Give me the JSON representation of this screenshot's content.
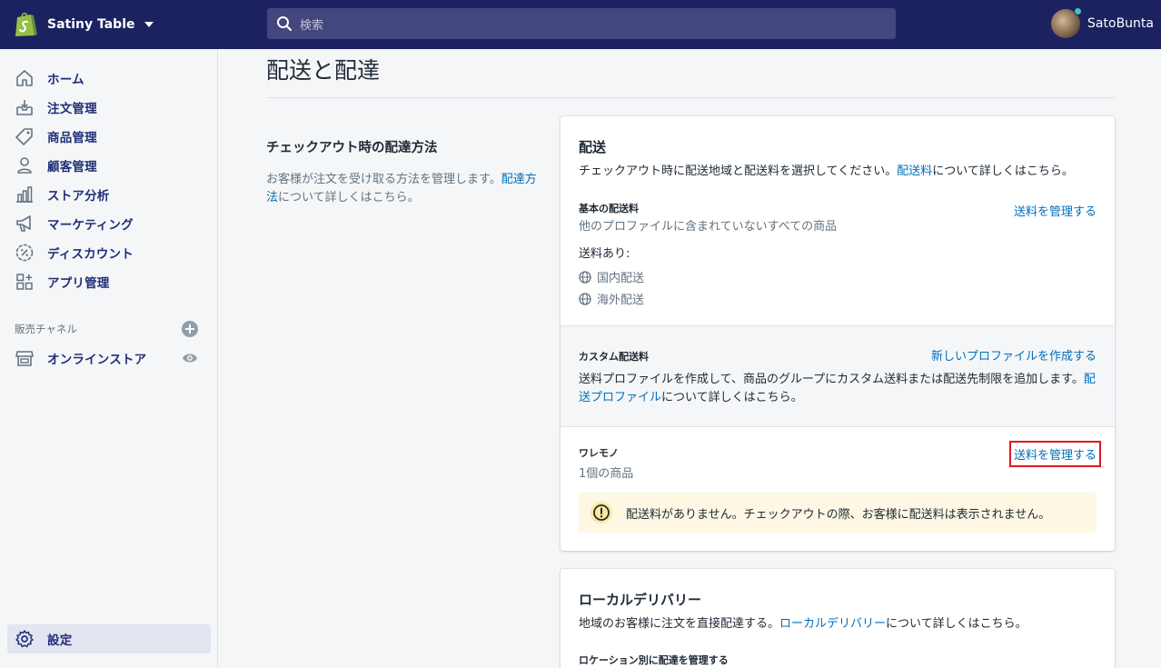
{
  "topbar": {
    "store_name": "Satiny Table",
    "search_placeholder": "検索",
    "user_name": "SatoBunta"
  },
  "sidebar": {
    "items": [
      {
        "label": "ホーム",
        "icon": "home-icon"
      },
      {
        "label": "注文管理",
        "icon": "orders-icon"
      },
      {
        "label": "商品管理",
        "icon": "tag-icon"
      },
      {
        "label": "顧客管理",
        "icon": "customer-icon"
      },
      {
        "label": "ストア分析",
        "icon": "analytics-icon"
      },
      {
        "label": "マーケティング",
        "icon": "megaphone-icon"
      },
      {
        "label": "ディスカウント",
        "icon": "discount-icon"
      },
      {
        "label": "アプリ管理",
        "icon": "apps-icon"
      }
    ],
    "channels_title": "販売チャネル",
    "online_store": "オンラインストア",
    "settings": "設定"
  },
  "page": {
    "title": "配送と配達"
  },
  "section": {
    "title": "チェックアウト時の配達方法",
    "desc_prefix": "お客様が注文を受け取る方法を管理します。",
    "desc_link": "配達方法",
    "desc_suffix": "について詳しくはこちら。"
  },
  "shipping_card": {
    "title": "配送",
    "desc_prefix": "チェックアウト時に配送地域と配送料を選択してください。",
    "desc_link": "配送料",
    "desc_suffix": "について詳しくはこちら。",
    "general": {
      "heading": "基本の配送料",
      "subtitle": "他のプロファイルに含まれていないすべての商品",
      "manage_link": "送料を管理する",
      "rates_label": "送料あり:",
      "zones": [
        "国内配送",
        "海外配送"
      ]
    },
    "custom": {
      "heading": "カスタム配送料",
      "create_link": "新しいプロファイルを作成する",
      "desc_prefix": "送料プロファイルを作成して、商品のグループにカスタム送料または配送先制限を追加します。",
      "desc_link": "配送プロファイル",
      "desc_suffix": "について詳しくはこちら。"
    },
    "profile": {
      "name": "ワレモノ",
      "count": "1個の商品",
      "manage_link": "送料を管理する",
      "warning": "配送料がありません。チェックアウトの際、お客様に配送料は表示されません。"
    }
  },
  "local_card": {
    "title": "ローカルデリバリー",
    "desc_prefix": "地域のお客様に注文を直接配達する。",
    "desc_link": "ローカルデリバリー",
    "desc_suffix": "について詳しくはこちら。",
    "sub_heading": "ロケーション別に配達を管理する"
  },
  "colors": {
    "topbar": "#1c2260",
    "link": "#006fbb",
    "nav_text": "#202e78",
    "highlight": "#e0161a",
    "warning_bg": "#fdf7e3"
  }
}
